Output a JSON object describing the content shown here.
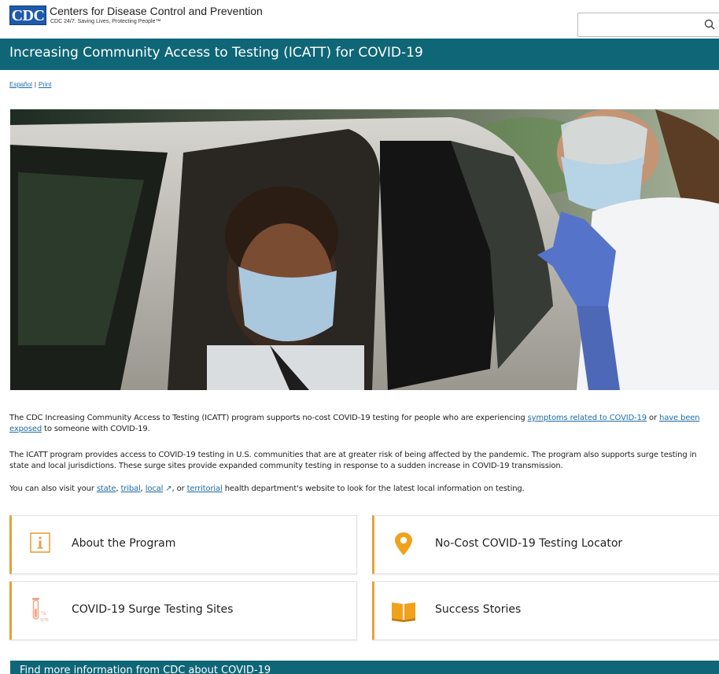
{
  "header": {
    "logo_text": "CDC",
    "org_name": "Centers for Disease Control and Prevention",
    "tagline": "CDC 24/7: Saving Lives, Protecting People™",
    "search_placeholder": ""
  },
  "page": {
    "title": "Increasing Community Access to Testing (ICATT) for COVID-19",
    "lang_link": "Español",
    "separator": "|",
    "print_link": "Print"
  },
  "intro": {
    "p1_a": "The CDC Increasing Community Access to Testing (ICATT) program supports no-cost COVID-19 testing for people who are experiencing ",
    "p1_link1": "symptoms related to COVID-19",
    "p1_b": " or ",
    "p1_link2": "have been exposed",
    "p1_c": " to someone with COVID-19.",
    "p2": "The ICATT program provides access to COVID-19 testing in U.S. communities that are at greater risk of being affected by the pandemic. The program also supports surge testing in state and local jurisdictions. These surge sites provide expanded community testing in response to a sudden increase in COVID-19 transmission.",
    "p3_a": "You can also visit your ",
    "p3_link_state": "state",
    "p3_sep1": ", ",
    "p3_link_tribal": "tribal",
    "p3_sep2": ", ",
    "p3_link_local": "local",
    "p3_ext": " ↗",
    "p3_sep3": ", or ",
    "p3_link_territorial": "territorial",
    "p3_b": " health department's website to look for the latest local information on testing."
  },
  "cards": [
    {
      "label": "About the Program",
      "icon": "info-icon"
    },
    {
      "label": "No-Cost COVID-19 Testing Locator",
      "icon": "map-pin-icon"
    },
    {
      "label": "COVID-19 Surge Testing Sites",
      "icon": "test-tube-icon"
    },
    {
      "label": "Success Stories",
      "icon": "book-icon"
    }
  ],
  "footer_bar": {
    "label": "Find more information from CDC about COVID-19"
  },
  "colors": {
    "teal": "#0f6677",
    "accent": "#e6a23c",
    "link": "#1e6ba8",
    "cdc_blue": "#1e5aa8"
  }
}
